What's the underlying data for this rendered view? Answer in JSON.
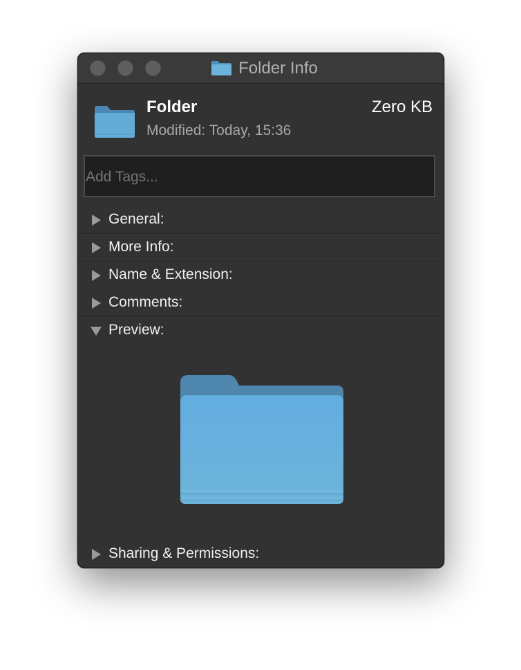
{
  "window": {
    "title": "Folder Info",
    "title_icon": "folder-icon"
  },
  "header": {
    "name": "Folder",
    "size": "Zero KB",
    "modified": "Modified:  Today, 15:36",
    "icon": "folder-icon"
  },
  "tags": {
    "placeholder": "Add Tags..."
  },
  "sections": {
    "general": "General:",
    "more_info": "More Info:",
    "name_extension": "Name & Extension:",
    "comments": "Comments:",
    "preview": "Preview:",
    "sharing": "Sharing & Permissions:"
  },
  "preview": {
    "icon": "folder-icon"
  },
  "colors": {
    "window_bg": "#323232",
    "folder_blue": "#5fa9d6"
  }
}
